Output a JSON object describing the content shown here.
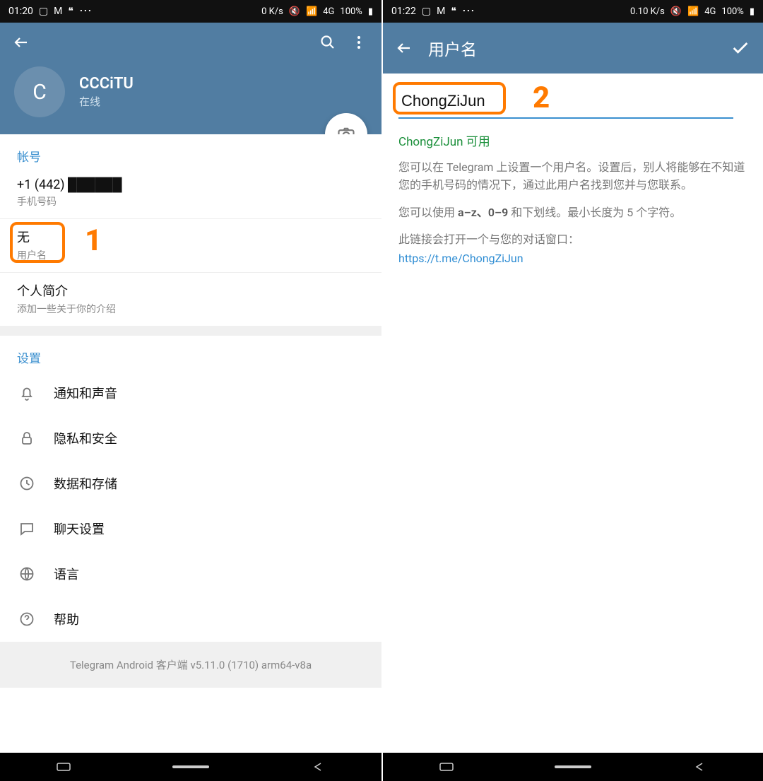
{
  "left": {
    "status": {
      "time": "01:20",
      "net": "0 K/s",
      "battery": "100%"
    },
    "profile": {
      "avatar_letter": "C",
      "name": "CCCiTU",
      "status": "在线"
    },
    "account": {
      "section": "帐号",
      "phone": "+1 (442) ██████",
      "phone_label": "手机号码",
      "username_value": "无",
      "username_label": "用户名",
      "bio_title": "个人简介",
      "bio_sub": "添加一些关于你的介绍"
    },
    "settings": {
      "section": "设置",
      "items": [
        {
          "label": "通知和声音",
          "icon": "bell-icon"
        },
        {
          "label": "隐私和安全",
          "icon": "lock-icon"
        },
        {
          "label": "数据和存储",
          "icon": "clock-icon"
        },
        {
          "label": "聊天设置",
          "icon": "chat-icon"
        },
        {
          "label": "语言",
          "icon": "globe-icon"
        },
        {
          "label": "帮助",
          "icon": "help-icon"
        }
      ]
    },
    "version": "Telegram Android 客户端 v5.11.0 (1710) arm64-v8a",
    "annotation": "1"
  },
  "right": {
    "status": {
      "time": "01:22",
      "net": "0.10 K/s",
      "battery": "100%"
    },
    "title": "用户名",
    "input_value": "ChongZiJun",
    "availability": "ChongZiJun 可用",
    "help1": "您可以在 Telegram 上设置一个用户名。设置后，别人将能够在不知道您的手机号码的情况下，通过此用户名找到您并与您联系。",
    "help2_a": "您可以使用 ",
    "help2_b": "a–z、0–9",
    "help2_c": " 和下划线。最小长度为 5 个字符。",
    "help3": "此链接会打开一个与您的对话窗口：",
    "link": "https://t.me/ChongZiJun",
    "annotation": "2"
  }
}
